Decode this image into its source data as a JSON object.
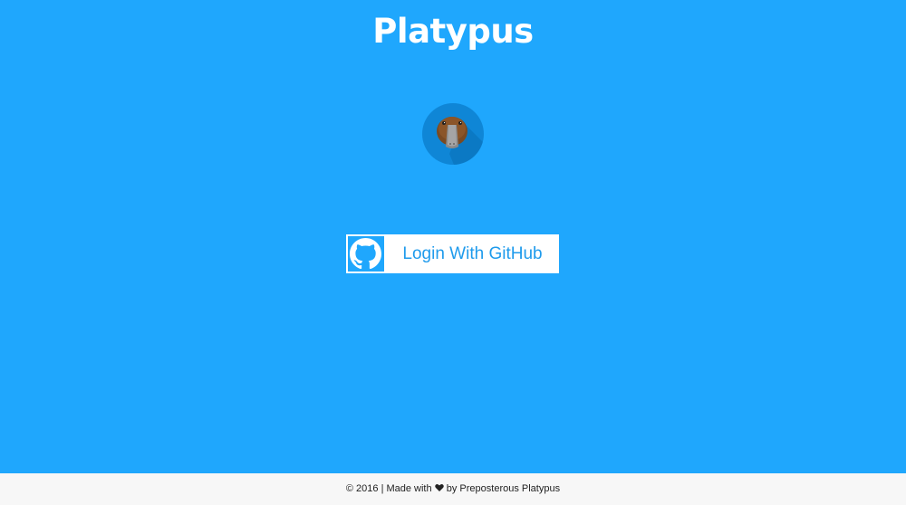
{
  "app": {
    "title": "Platypus"
  },
  "logo": {
    "icon": "platypus-logo-icon"
  },
  "login": {
    "label": "Login With GitHub",
    "icon": "github-icon"
  },
  "footer": {
    "prefix": "© 2016 | Made with",
    "heart_icon": "heart-icon",
    "suffix": "by Preposterous Platypus"
  },
  "colors": {
    "background": "#1fa7fd",
    "button_text": "#1f9bec",
    "footer_bg": "#f7f7f7"
  }
}
